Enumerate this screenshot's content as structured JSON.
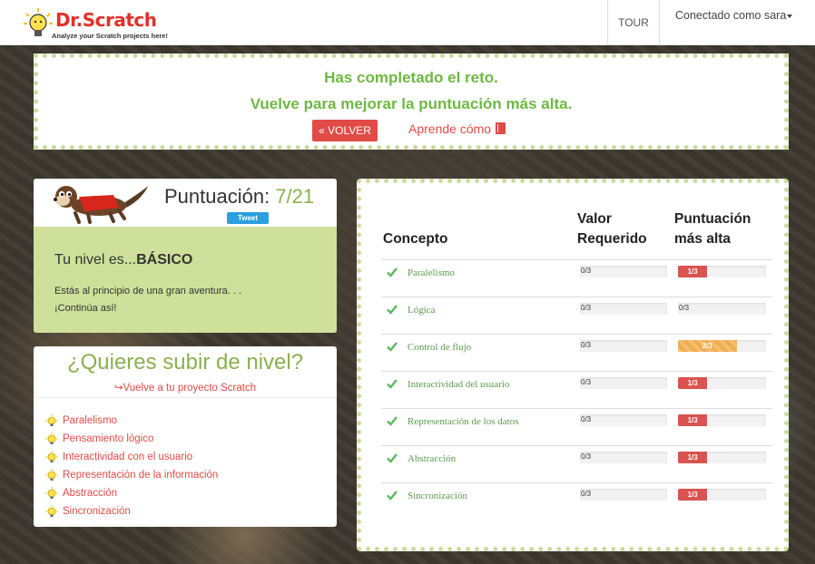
{
  "navbar": {
    "logo_title": "Dr.Scratch",
    "logo_subtitle": "Analyze your Scratch projects here!",
    "tour_label": "TOUR",
    "user_label": "Conectado como sara"
  },
  "banner": {
    "line1": "Has completado el reto.",
    "line2": "Vuelve para mejorar la puntuación más alta.",
    "back_label": "« VOLVER",
    "learn_label": "Aprende cómo"
  },
  "score": {
    "label": "Puntuación: ",
    "value": "7/21",
    "tweet_label": "Tweet",
    "level_prefix": "Tu nivel es...",
    "level_name": "BÁSICO",
    "desc_line1": "Estás al principio de una gran aventura. . .",
    "desc_line2": "¡Continúa así!"
  },
  "upgrade": {
    "title": "¿Quieres subir de nivel?",
    "link": "Vuelve a tu proyecto Scratch",
    "items": [
      "Paralelismo",
      "Pensamiento lógico",
      "Interactividad con el usuario",
      "Representación de la información",
      "Abstracción",
      "Sincronización"
    ]
  },
  "table": {
    "col_concept": "Concepto",
    "col_required_1": "Valor",
    "col_required_2": "Requerido",
    "col_high_1": "Puntuación",
    "col_high_2": "más alta",
    "rows": [
      {
        "concept": "Paralelismo",
        "required": "0/3",
        "high": "1/3",
        "high_fraction": 0.333,
        "style": "red"
      },
      {
        "concept": "Lógica",
        "required": "0/3",
        "high": "0/3",
        "high_fraction": 0,
        "style": "none"
      },
      {
        "concept": "Control de flujo",
        "required": "0/3",
        "high": "2/3",
        "high_fraction": 0.667,
        "style": "orange"
      },
      {
        "concept": "Interactividad del usuario",
        "required": "0/3",
        "high": "1/3",
        "high_fraction": 0.333,
        "style": "red"
      },
      {
        "concept": "Representación de los datos",
        "required": "0/3",
        "high": "1/3",
        "high_fraction": 0.333,
        "style": "red"
      },
      {
        "concept": "Abstracción",
        "required": "0/3",
        "high": "1/3",
        "high_fraction": 0.333,
        "style": "red"
      },
      {
        "concept": "Sincronización",
        "required": "0/3",
        "high": "1/3",
        "high_fraction": 0.333,
        "style": "red"
      }
    ]
  },
  "colors": {
    "accent_green": "#6fb843",
    "accent_red": "#e24b45",
    "level_bg": "#cfe09a"
  }
}
